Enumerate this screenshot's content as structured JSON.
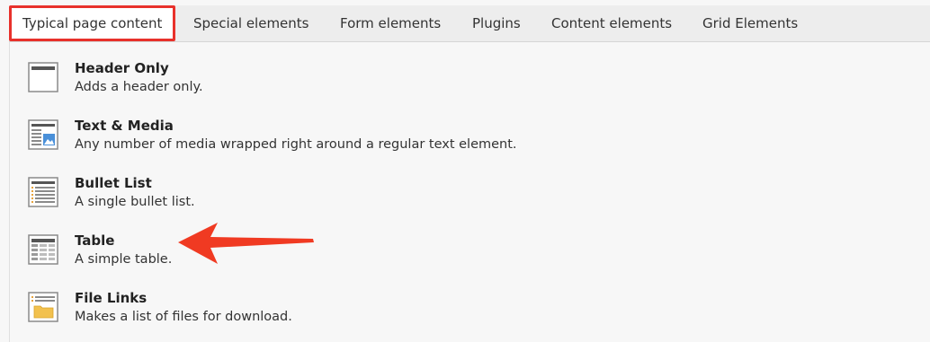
{
  "tabs": [
    {
      "label": "Typical page content",
      "active": true
    },
    {
      "label": "Special elements",
      "active": false
    },
    {
      "label": "Form elements",
      "active": false
    },
    {
      "label": "Plugins",
      "active": false
    },
    {
      "label": "Content elements",
      "active": false
    },
    {
      "label": "Grid Elements",
      "active": false
    }
  ],
  "items": [
    {
      "title": "Header Only",
      "description": "Adds a header only.",
      "icon": "header-only-icon"
    },
    {
      "title": "Text & Media",
      "description": "Any number of media wrapped right around a regular text element.",
      "icon": "text-media-icon"
    },
    {
      "title": "Bullet List",
      "description": "A single bullet list.",
      "icon": "bullet-list-icon"
    },
    {
      "title": "Table",
      "description": "A simple table.",
      "icon": "table-icon"
    },
    {
      "title": "File Links",
      "description": "Makes a list of files for download.",
      "icon": "file-links-icon"
    }
  ],
  "colors": {
    "highlight": "#e8312b",
    "arrow": "#f03a22"
  }
}
